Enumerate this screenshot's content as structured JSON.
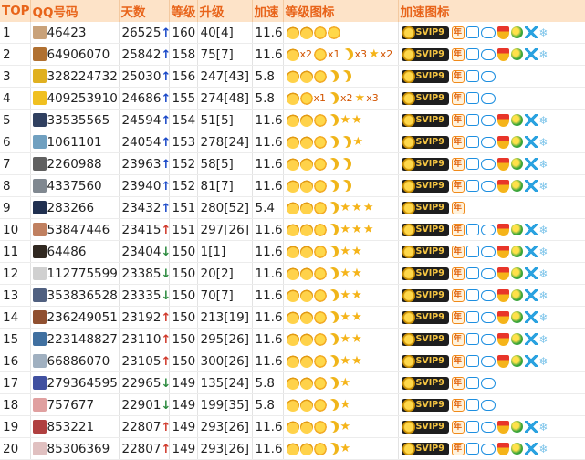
{
  "headers": [
    "TOP",
    "QQ号码",
    "天数",
    "等级",
    "升级",
    "加速",
    "等级图标",
    "加速图标"
  ],
  "rows": [
    {
      "top": "1",
      "qq": "46423",
      "days": "26525",
      "arrow": "up",
      "level": "160",
      "up": "40[4]",
      "speed": "11.6",
      "lv": "c c s s",
      "sp": "svip nian sq game medal ball x snow",
      "avatar": "#c9a27a"
    },
    {
      "top": "2",
      "qq": "64906070",
      "days": "25842",
      "arrow": "up",
      "level": "158",
      "up": "75[7]",
      "speed": "11.6",
      "lv": "cx2 sx1 mx3 stx2",
      "sp": "svip nian sq game medal ball x snow",
      "avatar": "#b07030"
    },
    {
      "top": "3",
      "qq": "328224732",
      "days": "25030",
      "arrow": "up",
      "level": "156",
      "up": "247[43]",
      "speed": "5.8",
      "lv": "c c s m m",
      "sp": "svip nian sq game",
      "avatar": "#e0b020"
    },
    {
      "top": "4",
      "qq": "409253910",
      "days": "24686",
      "arrow": "up",
      "level": "155",
      "up": "274[48]",
      "speed": "5.8",
      "lv": "c sx1 mx2 stx3",
      "sp": "svip nian sq game",
      "avatar": "#f0c020"
    },
    {
      "top": "5",
      "qq": "33535565",
      "days": "24594",
      "arrow": "up",
      "level": "154",
      "up": "51[5]",
      "speed": "11.6",
      "lv": "c c s m st st",
      "sp": "svip nian sq game medal ball x snow",
      "avatar": "#304060"
    },
    {
      "top": "6",
      "qq": "1061101",
      "days": "24054",
      "arrow": "up",
      "level": "153",
      "up": "278[24]",
      "speed": "11.6",
      "lv": "c c s m m st",
      "sp": "svip nian sq game medal ball x snow",
      "avatar": "#70a0c0"
    },
    {
      "top": "7",
      "qq": "2260988",
      "days": "23963",
      "arrow": "up",
      "level": "152",
      "up": "58[5]",
      "speed": "11.6",
      "lv": "c c s m m",
      "sp": "svip nian sq game medal ball x snow",
      "avatar": "#606060"
    },
    {
      "top": "8",
      "qq": "4337560",
      "days": "23940",
      "arrow": "up",
      "level": "152",
      "up": "81[7]",
      "speed": "11.6",
      "lv": "c c s m m",
      "sp": "svip nian sq game medal ball x snow",
      "avatar": "#808890"
    },
    {
      "top": "9",
      "qq": "283266",
      "days": "23432",
      "arrow": "up",
      "level": "151",
      "up": "280[52]",
      "speed": "5.4",
      "lv": "c c s m st st st",
      "sp": "svip nian",
      "avatar": "#203050"
    },
    {
      "top": "10",
      "qq": "53847446",
      "days": "23415",
      "arrow": "upr",
      "level": "151",
      "up": "297[26]",
      "speed": "11.6",
      "lv": "c c s m st st st",
      "sp": "svip nian sq game medal ball x snow",
      "avatar": "#c08060"
    },
    {
      "top": "11",
      "qq": "64486",
      "days": "23404",
      "arrow": "down",
      "level": "150",
      "up": "1[1]",
      "speed": "11.6",
      "lv": "c c s m st st",
      "sp": "svip nian sq game medal ball x snow",
      "avatar": "#302820"
    },
    {
      "top": "12",
      "qq": "112775599",
      "days": "23385",
      "arrow": "down",
      "level": "150",
      "up": "20[2]",
      "speed": "11.6",
      "lv": "c c s m st st",
      "sp": "svip nian sq game medal ball x snow",
      "avatar": "#d0d0d0"
    },
    {
      "top": "13",
      "qq": "353836528",
      "days": "23335",
      "arrow": "down",
      "level": "150",
      "up": "70[7]",
      "speed": "11.6",
      "lv": "c c s m st st",
      "sp": "svip nian sq game medal ball x snow",
      "avatar": "#506080"
    },
    {
      "top": "14",
      "qq": "236249051",
      "days": "23192",
      "arrow": "upr",
      "level": "150",
      "up": "213[19]",
      "speed": "11.6",
      "lv": "c c s m st st",
      "sp": "svip nian sq game medal ball x snow",
      "avatar": "#905030"
    },
    {
      "top": "15",
      "qq": "223148827",
      "days": "23110",
      "arrow": "upr",
      "level": "150",
      "up": "295[26]",
      "speed": "11.6",
      "lv": "c c s m st st",
      "sp": "svip nian sq game medal ball x snow",
      "avatar": "#4070a0"
    },
    {
      "top": "16",
      "qq": "66886070",
      "days": "23105",
      "arrow": "upr",
      "level": "150",
      "up": "300[26]",
      "speed": "11.6",
      "lv": "c c s m st st",
      "sp": "svip nian sq game medal ball x snow",
      "avatar": "#a0b0c0"
    },
    {
      "top": "17",
      "qq": "279364595",
      "days": "22965",
      "arrow": "down",
      "level": "149",
      "up": "135[24]",
      "speed": "5.8",
      "lv": "c c s m st",
      "sp": "svip nian sq game",
      "avatar": "#4050a0"
    },
    {
      "top": "18",
      "qq": "757677",
      "days": "22901",
      "arrow": "down",
      "level": "149",
      "up": "199[35]",
      "speed": "5.8",
      "lv": "c c s m st",
      "sp": "svip nian sq game",
      "avatar": "#e0a0a0"
    },
    {
      "top": "19",
      "qq": "853221",
      "days": "22807",
      "arrow": "upr",
      "level": "149",
      "up": "293[26]",
      "speed": "11.6",
      "lv": "c c s m st",
      "sp": "svip nian sq game medal ball x snow",
      "avatar": "#b04040"
    },
    {
      "top": "20",
      "qq": "85306369",
      "days": "22807",
      "arrow": "upr",
      "level": "149",
      "up": "293[26]",
      "speed": "11.6",
      "lv": "c c s m st",
      "sp": "svip nian sq game medal ball x snow",
      "avatar": "#e0c0c0"
    }
  ],
  "arrows": {
    "up": "↑",
    "upr": "↑",
    "down": "↓"
  },
  "svip_label": "SVIP9",
  "nian_label": "年"
}
